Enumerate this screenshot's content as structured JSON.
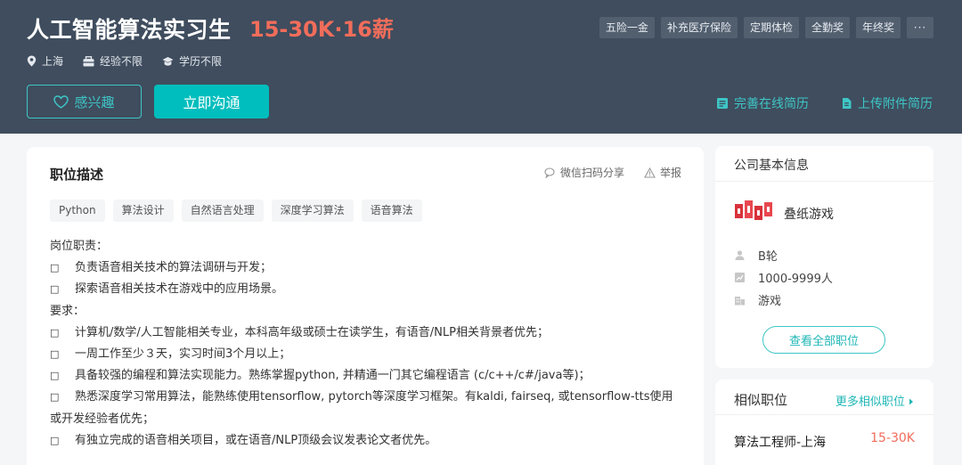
{
  "job": {
    "title": "人工智能算法实习生",
    "salary": "15-30K·16薪",
    "location": "上海",
    "experience": "经验不限",
    "education": "学历不限",
    "benefits": [
      "五险一金",
      "补充医疗保险",
      "定期体检",
      "全勤奖",
      "年终奖"
    ],
    "benefits_more": "···"
  },
  "buttons": {
    "interest": "感兴趣",
    "chat": "立即沟通",
    "online_resume": "完善在线简历",
    "upload_resume": "上传附件简历"
  },
  "description": {
    "title": "职位描述",
    "share": "微信扫码分享",
    "report": "举报",
    "tags": [
      "Python",
      "算法设计",
      "自然语言处理",
      "深度学习算法",
      "语音算法"
    ],
    "bullet_char": "□",
    "lines": [
      {
        "bullet": false,
        "text": "岗位职责："
      },
      {
        "bullet": true,
        "text": "负责语音相关技术的算法调研与开发；"
      },
      {
        "bullet": true,
        "text": "探索语音相关技术在游戏中的应用场景。"
      },
      {
        "bullet": false,
        "text": "要求："
      },
      {
        "bullet": true,
        "text": "计算机/数学/人工智能相关专业，本科高年级或硕士在读学生，有语音/NLP相关背景者优先；"
      },
      {
        "bullet": true,
        "text": "一周工作至少３天，实习时间3个月以上；"
      },
      {
        "bullet": true,
        "text": "具备较强的编程和算法实现能力。熟练掌握python, 并精通一门其它编程语言 (c/c++/c#/java等)；"
      },
      {
        "bullet": true,
        "text": "熟悉深度学习常用算法，能熟练使用tensorflow, pytorch等深度学习框架。有kaldi, fairseq, 或tensorflow-tts使用或开发经验者优先；"
      },
      {
        "bullet": true,
        "text": "有独立完成的语音相关项目，或在语音/NLP顶级会议发表论文者优先。"
      }
    ]
  },
  "company": {
    "section_title": "公司基本信息",
    "name": "叠纸游戏",
    "stage": "B轮",
    "size": "1000-9999人",
    "industry": "游戏",
    "view_all": "查看全部职位"
  },
  "similar": {
    "section_title": "相似职位",
    "more": "更多相似职位",
    "jobs": [
      {
        "title": "算法工程师-上海",
        "salary": "15-30K"
      }
    ]
  },
  "colors": {
    "header_bg": "#3f4d5e",
    "accent": "#00bebd",
    "salary": "#f26d5b"
  }
}
